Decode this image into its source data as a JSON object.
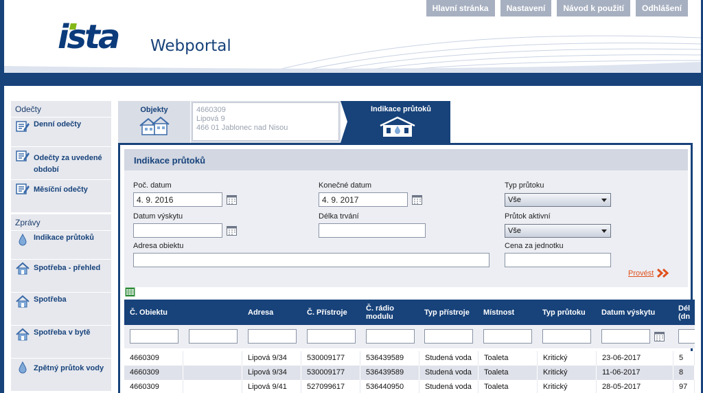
{
  "header": {
    "logo_text": "ista",
    "brand": "Webportal",
    "nav": [
      "Hlavní stránka",
      "Nastavení",
      "Návod k použití",
      "Odhlášení"
    ]
  },
  "sidebar": {
    "groups": [
      {
        "title": "Odečty",
        "items": [
          {
            "label": "Denní odečty",
            "icon": "reading-icon"
          },
          {
            "label": "Odečty za uvedené období",
            "icon": "reading-icon"
          },
          {
            "label": "Měsíční odečty",
            "icon": "reading-icon"
          }
        ]
      },
      {
        "title": "Zprávy",
        "items": [
          {
            "label": "Indikace průtoků",
            "icon": "water-drop-icon"
          },
          {
            "label": "Spotřeba - přehled",
            "icon": "house-icon"
          },
          {
            "label": "Spotřeba",
            "icon": "house-icon"
          },
          {
            "label": "Spotřeba v bytě",
            "icon": "house-icon"
          },
          {
            "label": "Zpětný průtok vody",
            "icon": "water-drop-icon"
          }
        ]
      }
    ]
  },
  "tabs": {
    "objekty": "Objekty",
    "object_id": "4660309",
    "object_street": "Lipová 9",
    "object_city": "466 01 Jablonec nad Nisou",
    "active": "Indikace průtoků"
  },
  "content": {
    "title": "Indikace průtoků",
    "filters": {
      "start_date_label": "Poč. datum",
      "start_date_value": "4. 9. 2016",
      "end_date_label": "Konečné datum",
      "end_date_value": "4. 9. 2017",
      "flow_type_label": "Typ průtoku",
      "flow_type_value": "Vše",
      "occurrence_date_label": "Datum výskytu",
      "duration_label": "Délka trvání",
      "flow_active_label": "Průtok aktivní",
      "flow_active_value": "Vše",
      "address_label": "Adresa obiektu",
      "unit_price_label": "Cena za jednotku",
      "submit_label": "Provést"
    },
    "table": {
      "columns": [
        "Č. Obiektu",
        "",
        "Adresa",
        "Č. Přístroje",
        "Č. rádio modulu",
        "Typ přístroje",
        "Místnost",
        "Typ průtoku",
        "Datum výskytu",
        "Dél (dn"
      ],
      "rows": [
        [
          "4660309",
          "",
          "Lipová 9/34",
          "530009177",
          "536439589",
          "Studená voda",
          "Toaleta",
          "Kritický",
          "23-06-2017",
          "5"
        ],
        [
          "4660309",
          "",
          "Lipová 9/34",
          "530009177",
          "536439589",
          "Studená voda",
          "Toaleta",
          "Kritický",
          "11-06-2017",
          "8"
        ],
        [
          "4660309",
          "",
          "Lipová 9/41",
          "527099617",
          "536440950",
          "Studená voda",
          "Toaleta",
          "Kritický",
          "28-05-2017",
          "97"
        ]
      ]
    }
  },
  "colors": {
    "navy": "#17427a",
    "accent_orange": "#e0501c",
    "logo_green": "#84b817",
    "nav_gray": "#a7b0c0",
    "row_white": "#ffffff",
    "row_gray": "#dfe2ea"
  }
}
